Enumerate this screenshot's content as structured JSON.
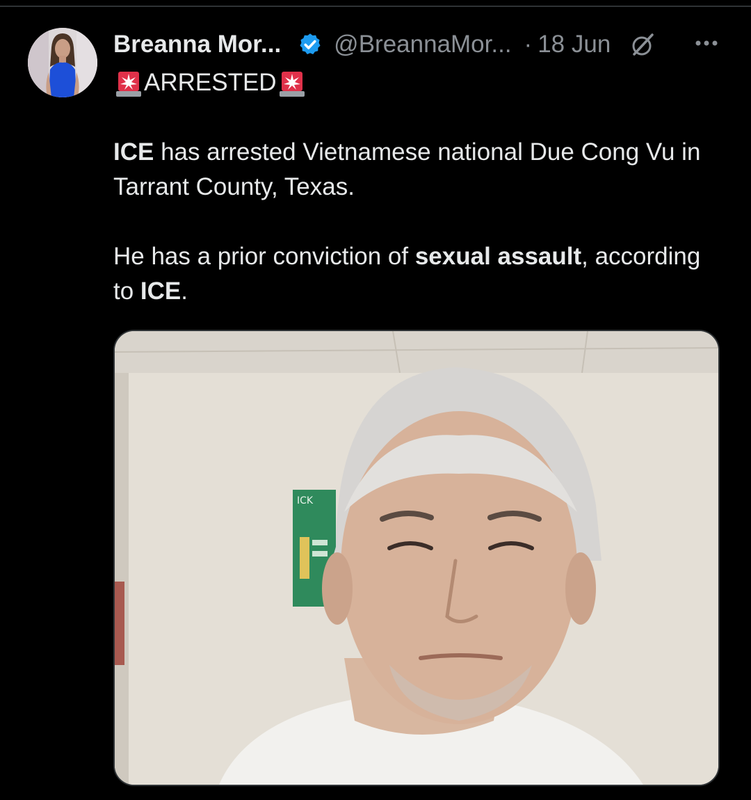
{
  "post": {
    "author": {
      "name": "Breanna Mor...",
      "handle": "@BreannaMor...",
      "avatar_icon": "profile-photo"
    },
    "dot": "·",
    "date": "18 Jun",
    "icons": {
      "verified": "verified-badge-icon",
      "grok": "grok-icon",
      "more": "more-options-icon",
      "siren": "police-siren-emoji"
    },
    "headline": "ARRESTED",
    "paragraph1": {
      "bold_lead": "ICE",
      "rest": " has arrested Vietnamese national Due Cong Vu in Tarrant County, Texas."
    },
    "paragraph2": {
      "part1": "He has a prior conviction of ",
      "bold_mid": "sexual assault",
      "part2": ", according to ",
      "bold_end": "ICE",
      "part3": "."
    },
    "media": {
      "type": "photo",
      "sign_text": "ICK"
    }
  },
  "colors": {
    "background": "#000000",
    "text": "#e7e9ea",
    "muted": "#8b9096",
    "verified_blue": "#1d9bf0",
    "border": "#2f3336"
  }
}
